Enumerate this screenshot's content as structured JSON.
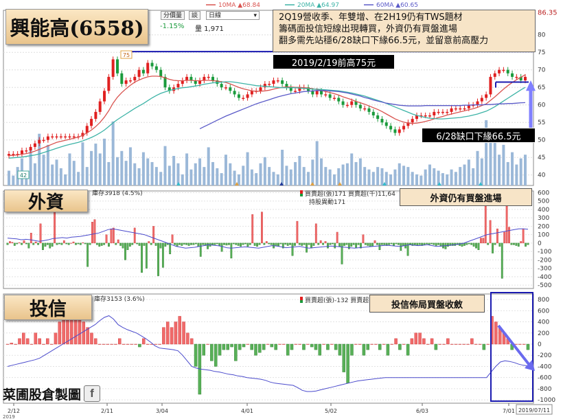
{
  "title": "興能高(6558)",
  "panel_titles": {
    "foreign": "外資",
    "trust": "投信"
  },
  "footer_logo": "菜圃股倉製圖",
  "logo_icon": "facebook-f-icon",
  "toolbar": {
    "price_change": "-1.15%",
    "volume_label": "量 1,971",
    "btn_fenjiabiao": "分價量",
    "btn_tan": "談",
    "period_select": "日線"
  },
  "ma_legend": [
    {
      "name": "10MA",
      "value": "68.84",
      "color": "#d9534f"
    },
    {
      "name": "20MA",
      "value": "64.97",
      "color": "#3cb3a6"
    },
    {
      "name": "60MA",
      "value": "60.65",
      "color": "#5a5ac8"
    }
  ],
  "price_right_label": "86.35",
  "annotations": {
    "main_note": [
      "2Q19營收季、年雙增、在2H19仍有TWS題材",
      "籌碼面投信短線出現轉買，外資仍有買盤進場",
      "翻多需先站穩6/28缺口下緣66.5元，並留意前高壓力"
    ],
    "prev_high": "2019/2/19前高75元",
    "gap_label": "6/28缺口下緣66.5元",
    "foreign_note": "外資仍有買盤進場",
    "trust_note": "投信佈局買盤收斂",
    "peak_tag": "75",
    "low_tag": "42"
  },
  "foreign_header": {
    "holding": "庫存3918 (4.5%)",
    "legend": "買賣超(張)171  買賣超(千)11,64",
    "change": "持股異動171"
  },
  "trust_header": {
    "holding": "庫存3153 (3.6%)",
    "legend": "買賣超(張)-132  買賣超"
  },
  "x_axis": {
    "labels": [
      "2/12",
      "2/11",
      "3/04",
      "4/01",
      "5/02",
      "6/03",
      "7/01"
    ],
    "end_date": "2019/07/11",
    "year_label": "2019"
  },
  "chart_data": [
    {
      "type": "candlestick",
      "y_ticks": [
        40,
        45,
        50,
        55,
        60,
        65,
        70,
        75,
        80
      ],
      "ylim": [
        37,
        87
      ],
      "reference_lines": [
        {
          "label": "2019/2/19前高75元",
          "value": 75.2
        },
        {
          "label": "6/28缺口下緣66.5元",
          "value": 66.5
        }
      ],
      "close": [
        46,
        46,
        46,
        47,
        47,
        48,
        49,
        50,
        50,
        51,
        51,
        51,
        51,
        51,
        51,
        51,
        51,
        52,
        54,
        56,
        58,
        61,
        64,
        68,
        73,
        69,
        66,
        67,
        67,
        68,
        70,
        69,
        72,
        71,
        70,
        68,
        65,
        64,
        65,
        66,
        67,
        68,
        67,
        66,
        67,
        68,
        68,
        67,
        66,
        65,
        65,
        64,
        63,
        62,
        62,
        63,
        64,
        64,
        65,
        66,
        66,
        67,
        67,
        66,
        65,
        64,
        64,
        65,
        65,
        64,
        63,
        64,
        63,
        63,
        62,
        62,
        61,
        60,
        60,
        61,
        60,
        59,
        59,
        58,
        57,
        56,
        55,
        54,
        53,
        52,
        53,
        54,
        55,
        56,
        57,
        57,
        57,
        57,
        58,
        58,
        58,
        58,
        59,
        59,
        59,
        59,
        60,
        60,
        61,
        62,
        63,
        68,
        69,
        70,
        70,
        69,
        68,
        68,
        67,
        68
      ],
      "ma10": [
        45.5,
        45.6,
        45.7,
        45.9,
        46.1,
        46.4,
        46.8,
        47.3,
        47.8,
        48.3,
        48.8,
        49.3,
        49.6,
        49.9,
        50.2,
        50.5,
        50.8,
        51.3,
        52.0,
        52.8,
        53.8,
        55.0,
        56.5,
        58.3,
        60.5,
        62.2,
        63.5,
        64.6,
        65.6,
        66.5,
        67.1,
        67.6,
        68.0,
        68.2,
        68.2,
        68.1,
        67.7,
        67.3,
        67.0,
        66.9,
        66.9,
        67.0,
        67.0,
        66.9,
        66.9,
        67.0,
        67.0,
        66.9,
        66.8,
        66.6,
        66.4,
        66.0,
        65.5,
        65.0,
        64.6,
        64.3,
        64.0,
        63.9,
        63.9,
        64.0,
        64.2,
        64.5,
        64.8,
        65.0,
        65.1,
        65.1,
        65.0,
        65.0,
        64.9,
        64.8,
        64.6,
        64.4,
        64.1,
        63.8,
        63.5,
        63.2,
        62.8,
        62.3,
        61.9,
        61.5,
        61.0,
        60.6,
        60.2,
        59.7,
        59.2,
        58.7,
        58.1,
        57.4,
        56.7,
        56.0,
        55.5,
        55.1,
        54.8,
        54.7,
        54.8,
        55.0,
        55.3,
        55.6,
        56.0,
        56.4,
        56.7,
        57.1,
        57.4,
        57.7,
        58.0,
        58.3,
        58.6,
        58.9,
        59.3,
        59.8,
        60.3,
        61.3,
        62.3,
        63.4,
        64.5,
        65.5,
        66.4,
        67.2,
        67.9,
        68.6
      ],
      "ma20": [
        44.8,
        44.9,
        45.0,
        45.1,
        45.3,
        45.5,
        45.7,
        46.0,
        46.4,
        46.8,
        47.2,
        47.6,
        48.0,
        48.4,
        48.7,
        49.0,
        49.3,
        49.7,
        50.2,
        50.7,
        51.3,
        52.0,
        52.8,
        53.8,
        54.9,
        55.8,
        56.6,
        57.4,
        58.2,
        59.0,
        59.7,
        60.4,
        61.2,
        62.0,
        62.7,
        63.3,
        63.7,
        64.1,
        64.4,
        64.7,
        64.9,
        65.0,
        65.2,
        65.4,
        65.6,
        65.9,
        66.1,
        66.3,
        66.4,
        66.5,
        66.6,
        66.6,
        66.5,
        66.3,
        66.1,
        65.9,
        65.7,
        65.5,
        65.4,
        65.3,
        65.2,
        65.1,
        65.0,
        64.9,
        64.9,
        64.9,
        64.9,
        64.8,
        64.7,
        64.6,
        64.5,
        64.5,
        64.4,
        64.3,
        64.2,
        64.1,
        64.0,
        63.8,
        63.6,
        63.4,
        63.1,
        62.8,
        62.5,
        62.1,
        61.7,
        61.3,
        60.9,
        60.4,
        59.9,
        59.4,
        58.9,
        58.4,
        57.9,
        57.4,
        57.0,
        56.7,
        56.4,
        56.2,
        56.1,
        56.0,
        56.0,
        56.1,
        56.2,
        56.3,
        56.4,
        56.6,
        56.8,
        57.1,
        57.4,
        57.8,
        58.2,
        58.8,
        59.5,
        60.3,
        61.1,
        61.9,
        62.7,
        63.5,
        64.3,
        65.0
      ],
      "ma60": [
        null,
        null,
        null,
        null,
        null,
        null,
        null,
        null,
        null,
        null,
        null,
        null,
        null,
        null,
        null,
        null,
        null,
        null,
        null,
        null,
        null,
        null,
        null,
        null,
        null,
        null,
        null,
        null,
        null,
        null,
        null,
        null,
        null,
        null,
        null,
        null,
        null,
        null,
        null,
        null,
        null,
        null,
        null,
        null,
        53.2,
        53.8,
        54.4,
        55.0,
        55.6,
        56.2,
        56.8,
        57.3,
        57.8,
        58.3,
        58.8,
        59.3,
        59.8,
        60.3,
        60.7,
        61.1,
        61.5,
        61.9,
        62.3,
        62.6,
        62.9,
        63.2,
        63.4,
        63.6,
        63.8,
        63.9,
        64.0,
        64.1,
        64.1,
        64.1,
        64.0,
        63.9,
        63.8,
        63.6,
        63.4,
        63.1,
        62.8,
        62.5,
        62.1,
        61.8,
        61.4,
        61.1,
        60.8,
        60.5,
        60.3,
        60.1,
        59.9,
        59.8,
        59.7,
        59.7,
        59.7,
        59.7,
        59.8,
        59.8,
        59.8,
        59.8,
        59.8,
        59.8,
        59.8,
        59.8,
        59.8,
        59.9,
        59.9,
        60.0,
        60.0,
        60.0,
        60.1,
        60.1,
        60.2,
        60.3,
        60.3,
        60.4,
        60.4,
        60.5,
        60.6,
        60.65
      ],
      "volume": [
        1200,
        800,
        1500,
        2200,
        900,
        3000,
        1800,
        4200,
        2500,
        3300,
        1700,
        2100,
        1400,
        900,
        2600,
        2000,
        1100,
        3500,
        1500,
        2800,
        3400,
        2600,
        3800,
        1900,
        5200,
        2300,
        2800,
        2000,
        3100,
        1800,
        1400,
        2700,
        2200,
        1900,
        1500,
        1100,
        3200,
        1600,
        2400,
        1800,
        900,
        2600,
        1300,
        1800,
        2200,
        1500,
        3100,
        1900,
        1400,
        1000,
        2500,
        1800,
        1200,
        900,
        1600,
        2700,
        1300,
        1000,
        1800,
        2300,
        1500,
        1100,
        900,
        2900,
        1600,
        1300,
        1900,
        2400,
        1500,
        1100,
        2100,
        3600,
        2200,
        1500,
        1300,
        900,
        1400,
        1700,
        1800,
        2600,
        1900,
        2200,
        1500,
        1300,
        1100,
        1500,
        1400,
        1100,
        900,
        1300,
        1800,
        1600,
        1500,
        1100,
        900,
        800,
        1300,
        1700,
        1400,
        1200,
        1000,
        900,
        1300,
        1100,
        1500,
        1700,
        2100,
        1400,
        2800,
        2200,
        5300,
        3800,
        4300,
        2500,
        3300,
        1900,
        2700,
        1700,
        2200,
        2500
      ]
    },
    {
      "type": "bar",
      "name": "外資",
      "y_ticks": [
        600,
        500,
        400,
        300,
        200,
        100,
        0,
        -100,
        -200,
        -300,
        -400,
        -500
      ],
      "ylim": [
        -540,
        620
      ],
      "values": [
        -20,
        20,
        10,
        -30,
        -10,
        5,
        -20,
        30,
        -10,
        -60,
        120,
        -20,
        15,
        -20,
        230,
        -80,
        -40,
        -20,
        -60,
        -40,
        440,
        -20,
        -10,
        -20,
        30,
        -10,
        -20,
        0,
        15,
        -20,
        -10,
        -20,
        5,
        -10,
        -280,
        -20,
        250,
        280,
        -20,
        -40,
        -30,
        -20,
        100,
        -40,
        170,
        180,
        -20,
        40,
        -30,
        -60,
        -200,
        -80,
        -40,
        -20,
        180,
        -10,
        -30,
        -350,
        -30,
        -300,
        20,
        -20,
        200,
        -30,
        -390,
        -60,
        -290,
        -40,
        -20,
        -130,
        100,
        -20,
        -40,
        -20,
        -30,
        -15,
        -20,
        -30,
        -20,
        -20,
        -10,
        -40,
        -160,
        -20,
        -30,
        -70,
        -40,
        -20,
        -20,
        -10,
        -30,
        -100,
        -20,
        -25,
        -20,
        -180,
        -10,
        -20,
        -30,
        -40,
        -20,
        -10,
        -40,
        -20,
        340,
        -30,
        -40,
        -20,
        370,
        -20,
        20,
        -10,
        -20,
        -60,
        -30,
        -40,
        -10,
        -60,
        -15,
        -30,
        -20,
        -150,
        -30,
        260,
        -20,
        -30,
        -20,
        -110,
        -20,
        -60,
        -30,
        230,
        -20,
        30,
        -20,
        20,
        -60,
        -20,
        -10,
        -60,
        130,
        -40,
        -250,
        -30,
        -20,
        -70,
        -40,
        -20,
        -60,
        -20,
        -60,
        100,
        -20,
        -30,
        -40,
        -40,
        30,
        -20,
        -80,
        -20,
        -20,
        -30,
        -20,
        -10,
        -30,
        -10,
        -20,
        -90,
        -30,
        -60,
        -150,
        -20,
        -30,
        -20,
        -30,
        -20,
        -30,
        -20,
        -10,
        -20,
        -10,
        -20,
        -30,
        -20,
        -40,
        -60,
        -70,
        -40,
        -30,
        -30,
        -30,
        -20,
        -30,
        -40,
        -30,
        -20,
        -10,
        -20,
        -40,
        -60,
        -80,
        60,
        60,
        440,
        -20,
        270,
        -120,
        -20,
        170,
        -40,
        -420,
        130,
        440,
        190,
        -20,
        -20,
        -30,
        -40,
        20,
        170,
        -40,
        -20
      ],
      "holding": [
        60,
        55,
        50,
        40,
        45,
        40,
        30,
        20,
        30,
        40,
        55,
        60,
        65,
        60,
        70,
        75,
        80,
        90,
        100,
        110,
        120,
        140,
        160,
        170,
        160,
        150,
        140,
        130,
        120,
        110,
        100,
        80,
        60,
        40,
        20,
        0,
        -20,
        -40,
        -50,
        -60,
        -55,
        -50,
        -40,
        -30,
        -20,
        -25,
        -30,
        -40,
        -55,
        -60,
        -55,
        -50,
        -45,
        -50,
        -55,
        -60,
        -50,
        -40,
        -30,
        -35,
        -45,
        -55,
        -50,
        -45,
        -40,
        -50,
        -60,
        -55,
        -50,
        -45,
        -40,
        -35,
        -40,
        -45,
        -50,
        -55,
        -60,
        -55,
        -50,
        -45,
        -40,
        -35,
        -30,
        -25,
        -30,
        -35,
        -40,
        -30,
        -20,
        -25,
        -30,
        -25,
        -20,
        -30,
        -40,
        -35,
        -30,
        -25,
        -20,
        -10,
        0,
        20,
        40,
        60,
        80,
        100,
        110,
        120,
        130,
        140,
        150,
        160,
        170,
        170,
        165
      ]
    },
    {
      "type": "bar",
      "name": "投信",
      "y_ticks": [
        800,
        600,
        400,
        200,
        0,
        -200,
        -400,
        -600,
        -800,
        -1000
      ],
      "ylim": [
        -1060,
        900
      ],
      "values": [
        0,
        20,
        0,
        100,
        200,
        100,
        0,
        200,
        100,
        0,
        100,
        0,
        200,
        400,
        500,
        600,
        500,
        600,
        500,
        400,
        300,
        200,
        100,
        0,
        0,
        0,
        0,
        0,
        100,
        0,
        0,
        0,
        0,
        -50,
        100,
        0,
        0,
        0,
        0,
        300,
        400,
        300,
        400,
        500,
        400,
        200,
        100,
        -400,
        -900,
        -200,
        0,
        -300,
        -400,
        -200,
        -100,
        -100,
        -50,
        -300,
        -100,
        -50,
        0,
        -100,
        -200,
        -150,
        -100,
        0,
        -50,
        -100,
        0,
        0,
        -200,
        -100,
        0,
        0,
        -100,
        0,
        -50,
        -100,
        -200,
        0,
        -100,
        0,
        -100,
        -200,
        -500,
        -700,
        -200,
        0,
        0,
        -200,
        -100,
        0,
        0,
        -100,
        0,
        -200,
        0,
        100,
        -100,
        0,
        -200,
        100,
        200,
        200,
        100,
        0,
        100,
        -100,
        0,
        0,
        100,
        0,
        0,
        0,
        0,
        0,
        100,
        0,
        0,
        -100,
        0,
        500,
        400,
        300,
        200,
        100,
        -100,
        0,
        0,
        0,
        -100
      ],
      "holding": [
        -400,
        -380,
        -360,
        -340,
        -320,
        -300,
        -280,
        -250,
        -200,
        -150,
        -100,
        -50,
        0,
        50,
        100,
        150,
        200,
        250,
        300,
        350,
        420,
        480,
        510,
        450,
        350,
        300,
        260,
        230,
        200,
        150,
        100,
        40,
        -30,
        -70,
        -80,
        -90,
        -100,
        -120,
        -200,
        -300,
        -400,
        -430,
        -450,
        -460,
        -470,
        -490,
        -500,
        -520,
        -540,
        -550,
        -570,
        -580,
        -600,
        -610,
        -620,
        -630,
        -650,
        -680,
        -700,
        -710,
        -720,
        -730,
        -740,
        -780,
        -830,
        -850,
        -850,
        -840,
        -820,
        -800,
        -780,
        -760,
        -740,
        -720,
        -700,
        -680,
        -660,
        -650,
        -640,
        -630,
        -620,
        -610,
        -600,
        -600,
        -600,
        -600,
        -600,
        -600,
        -600,
        -600,
        -600,
        -600,
        -600,
        -600,
        -600,
        -600,
        -600,
        -600,
        -600,
        -600,
        -600,
        -600,
        -600,
        -600,
        -600,
        -500,
        -400,
        -320,
        -300,
        -310,
        -330,
        -360,
        -380,
        -390
      ]
    }
  ]
}
